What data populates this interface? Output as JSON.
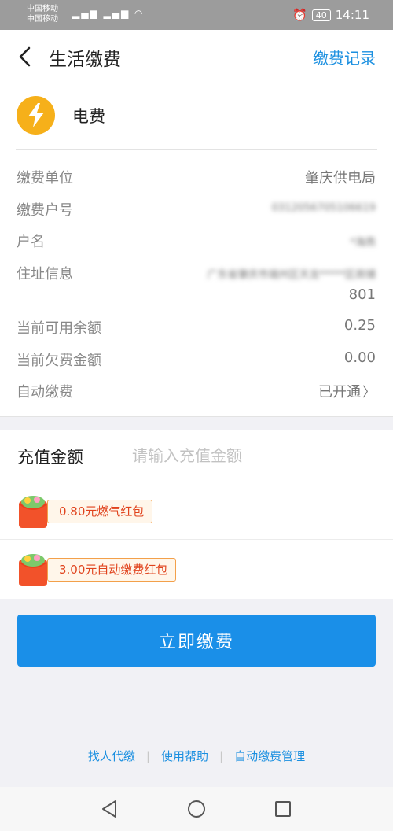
{
  "status_bar": {
    "carrier_1": "中国移动",
    "carrier_2": "中国移动",
    "battery": "40",
    "time": "14:11"
  },
  "header": {
    "title": "生活缴费",
    "history_link": "缴费记录"
  },
  "bill": {
    "type": "电费",
    "icon": "lightning-bolt-icon",
    "rows": [
      {
        "label": "缴费单位",
        "value": "肇庆供电局"
      },
      {
        "label": "缴费户号",
        "value": "0312056705106619"
      },
      {
        "label": "户名",
        "value": "*海燕"
      },
      {
        "label": "住址信息",
        "value": "广东省肇庆市端州区天龙*****区商铺",
        "value_line2": "801"
      },
      {
        "label": "当前可用余额",
        "value": "0.25"
      },
      {
        "label": "当前欠费金额",
        "value": "0.00"
      },
      {
        "label": "自动缴费",
        "value": "已开通"
      }
    ]
  },
  "recharge": {
    "label": "充值金额",
    "placeholder": "请输入充值金额",
    "value": ""
  },
  "coupons": [
    {
      "text": "0.80元燃气红包"
    },
    {
      "text": "3.00元自动缴费红包"
    }
  ],
  "pay_button": "立即缴费",
  "footer_links": [
    "找人代缴",
    "使用帮助",
    "自动缴费管理"
  ],
  "colors": {
    "accent": "#1a8fe8",
    "bolt": "#f6b01a",
    "coupon_text": "#e0421c"
  }
}
